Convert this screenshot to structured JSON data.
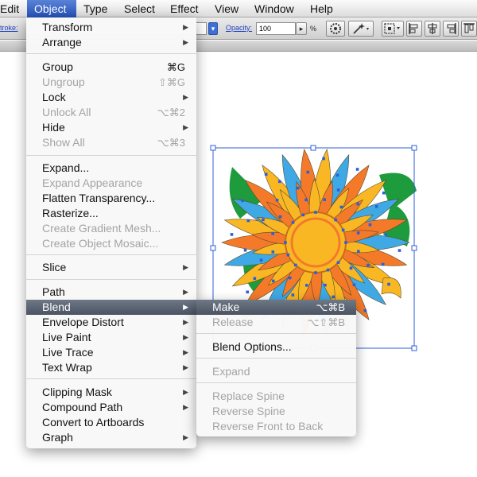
{
  "menubar": {
    "items": [
      {
        "label": "Edit"
      },
      {
        "label": "Object"
      },
      {
        "label": "Type"
      },
      {
        "label": "Select"
      },
      {
        "label": "Effect"
      },
      {
        "label": "View"
      },
      {
        "label": "Window"
      },
      {
        "label": "Help"
      }
    ]
  },
  "controlbar": {
    "stroke_label": "troke:",
    "opacity_label": "Opacity:",
    "opacity_value": "100",
    "percent": "%"
  },
  "object_menu": {
    "items": [
      {
        "label": "Transform",
        "shortcut": "",
        "submenu": true,
        "disabled": false
      },
      {
        "label": "Arrange",
        "shortcut": "",
        "submenu": true,
        "disabled": false
      },
      {
        "label": "Group",
        "shortcut": "⌘G",
        "submenu": false,
        "disabled": false
      },
      {
        "label": "Ungroup",
        "shortcut": "⇧⌘G",
        "submenu": false,
        "disabled": true
      },
      {
        "label": "Lock",
        "shortcut": "",
        "submenu": true,
        "disabled": false
      },
      {
        "label": "Unlock All",
        "shortcut": "⌥⌘2",
        "submenu": false,
        "disabled": true
      },
      {
        "label": "Hide",
        "shortcut": "",
        "submenu": true,
        "disabled": false
      },
      {
        "label": "Show All",
        "shortcut": "⌥⌘3",
        "submenu": false,
        "disabled": true
      },
      {
        "label": "Expand...",
        "shortcut": "",
        "submenu": false,
        "disabled": false
      },
      {
        "label": "Expand Appearance",
        "shortcut": "",
        "submenu": false,
        "disabled": true
      },
      {
        "label": "Flatten Transparency...",
        "shortcut": "",
        "submenu": false,
        "disabled": false
      },
      {
        "label": "Rasterize...",
        "shortcut": "",
        "submenu": false,
        "disabled": false
      },
      {
        "label": "Create Gradient Mesh...",
        "shortcut": "",
        "submenu": false,
        "disabled": true
      },
      {
        "label": "Create Object Mosaic...",
        "shortcut": "",
        "submenu": false,
        "disabled": true
      },
      {
        "label": "Slice",
        "shortcut": "",
        "submenu": true,
        "disabled": false
      },
      {
        "label": "Path",
        "shortcut": "",
        "submenu": true,
        "disabled": false
      },
      {
        "label": "Blend",
        "shortcut": "",
        "submenu": true,
        "disabled": false,
        "highlighted": true
      },
      {
        "label": "Envelope Distort",
        "shortcut": "",
        "submenu": true,
        "disabled": false
      },
      {
        "label": "Live Paint",
        "shortcut": "",
        "submenu": true,
        "disabled": false
      },
      {
        "label": "Live Trace",
        "shortcut": "",
        "submenu": true,
        "disabled": false
      },
      {
        "label": "Text Wrap",
        "shortcut": "",
        "submenu": true,
        "disabled": false
      },
      {
        "label": "Clipping Mask",
        "shortcut": "",
        "submenu": true,
        "disabled": false
      },
      {
        "label": "Compound Path",
        "shortcut": "",
        "submenu": true,
        "disabled": false
      },
      {
        "label": "Convert to Artboards",
        "shortcut": "",
        "submenu": false,
        "disabled": false
      },
      {
        "label": "Graph",
        "shortcut": "",
        "submenu": true,
        "disabled": false
      }
    ]
  },
  "blend_menu": {
    "items": [
      {
        "label": "Make",
        "shortcut": "⌥⌘B",
        "disabled": false,
        "highlighted": true
      },
      {
        "label": "Release",
        "shortcut": "⌥⇧⌘B",
        "disabled": true
      },
      {
        "label": "Blend Options...",
        "shortcut": "",
        "disabled": false
      },
      {
        "label": "Expand",
        "shortcut": "",
        "disabled": true
      },
      {
        "label": "Replace Spine",
        "shortcut": "",
        "disabled": true
      },
      {
        "label": "Reverse Spine",
        "shortcut": "",
        "disabled": true
      },
      {
        "label": "Reverse Front to Back",
        "shortcut": "",
        "disabled": true
      }
    ]
  },
  "colors": {
    "orange": "#f47a2a",
    "yellow": "#f9b823",
    "blue": "#3fa9e5",
    "green": "#1e9b3c",
    "selection": "#2d5fd9"
  }
}
